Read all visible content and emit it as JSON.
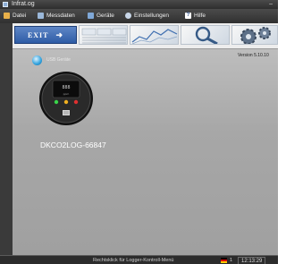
{
  "window": {
    "title": "Infrat.og"
  },
  "menu": {
    "items": [
      {
        "label": "Datei",
        "icon": "file-icon",
        "color": "#e8b04a"
      },
      {
        "label": "Messdaten",
        "icon": "data-icon",
        "color": "#9ab7d9"
      },
      {
        "label": "Geräte",
        "icon": "devices-icon",
        "color": "#7fa8d8"
      },
      {
        "label": "Einstellungen",
        "icon": "settings-icon",
        "color": "#c8d6e8"
      },
      {
        "label": "Hilfe",
        "icon": "help-icon",
        "color": "#ffffff"
      }
    ]
  },
  "toolbar": {
    "exit_label": "EXIT"
  },
  "main": {
    "usb_label": "USB Geräte",
    "version": "Version 5.10.10",
    "device": {
      "name": "DKCO2LOG-66847",
      "led_colors": [
        "#39d44a",
        "#f0b020",
        "#e03030"
      ]
    }
  },
  "status": {
    "hint": "Rechtsklick für Logger-Kontroll-Menü",
    "count": "1",
    "time": "12:13:29"
  }
}
